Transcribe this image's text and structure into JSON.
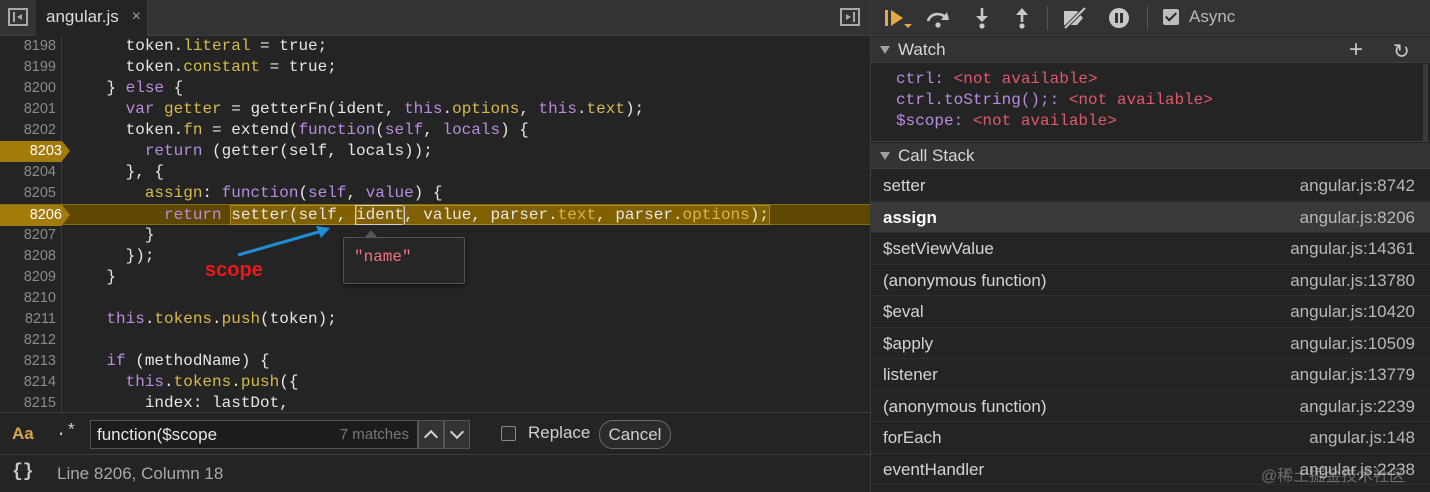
{
  "editor": {
    "tab_label": "angular.js",
    "tab_close": "×",
    "lines": [
      {
        "num": "8198",
        "html": "      token.<span class=\"prop\">literal</span> = <span class=\"val\">true</span>;"
      },
      {
        "num": "8199",
        "html": "      token.<span class=\"prop\">constant</span> = <span class=\"val\">true</span>;"
      },
      {
        "num": "8200",
        "html": "    } <span class=\"kw\">else</span> {"
      },
      {
        "num": "8201",
        "html": "      <span class=\"kw\">var</span> <span class=\"prop\">getter</span> = getterFn(ident, <span class=\"kw\">this</span>.<span class=\"prop\">options</span>, <span class=\"kw\">this</span>.<span class=\"prop\">text</span>);"
      },
      {
        "num": "8202",
        "html": "      token.<span class=\"prop\">fn</span> = extend(<span class=\"kw\">function</span>(<span class=\"kw\">self</span>, <span class=\"kw\">locals</span>) {"
      },
      {
        "num": "8203",
        "html": "        <span class=\"kw\">return</span> (getter(self, locals));",
        "breakpoint": true
      },
      {
        "num": "8204",
        "html": "      }, {"
      },
      {
        "num": "8205",
        "html": "        <span class=\"prop\">assign</span>: <span class=\"kw\">function</span>(<span class=\"kw\">self</span>, <span class=\"kw\">value</span>) {"
      },
      {
        "num": "8206",
        "html": "          <span class=\"kw\">return</span> <span class=\"hl\">setter(self, </span><span class=\"hl\" style=\"outline-color:#cfcfcf\">ident</span><span class=\"hl\">, value, parser.<span class=\"prop\">text</span>, parser.<span class=\"prop\">options</span>);</span>",
        "breakpoint": true,
        "current": true
      },
      {
        "num": "8207",
        "html": "        }"
      },
      {
        "num": "8208",
        "html": "      });"
      },
      {
        "num": "8209",
        "html": "    }"
      },
      {
        "num": "8210",
        "html": ""
      },
      {
        "num": "8211",
        "html": "    <span class=\"kw\">this</span>.<span class=\"prop\">tokens</span>.<span class=\"prop\">push</span>(token);"
      },
      {
        "num": "8212",
        "html": ""
      },
      {
        "num": "8213",
        "html": "    <span class=\"kw\">if</span> (methodName) {"
      },
      {
        "num": "8214",
        "html": "      <span class=\"kw\">this</span>.<span class=\"prop\">tokens</span>.<span class=\"prop\">push</span>({"
      },
      {
        "num": "8215",
        "html": "        index: lastDot,"
      }
    ],
    "tooltip_value": "\"name\"",
    "annotation": "scope"
  },
  "search": {
    "case_label": "Aa",
    "regex_label": ".*",
    "query": "function($scope",
    "match_count": "7 matches",
    "replace_label": "Replace",
    "cancel_label": "Cancel"
  },
  "status": {
    "pretty_print": "{}",
    "cursor": "Line 8206, Column 18"
  },
  "debugger": {
    "async_label": "Async",
    "watch": {
      "title": "Watch",
      "add": "+",
      "refresh": "↻",
      "items": [
        {
          "expr": "ctrl",
          "value": "<not available>"
        },
        {
          "expr": "ctrl.toString();",
          "value": "<not available>"
        },
        {
          "expr": "$scope",
          "value": "<not available>"
        }
      ]
    },
    "callstack": {
      "title": "Call Stack",
      "frames": [
        {
          "name": "setter",
          "loc": "angular.js:8742"
        },
        {
          "name": "assign",
          "loc": "angular.js:8206",
          "selected": true
        },
        {
          "name": "$setViewValue",
          "loc": "angular.js:14361"
        },
        {
          "name": "(anonymous function)",
          "loc": "angular.js:13780"
        },
        {
          "name": "$eval",
          "loc": "angular.js:10420"
        },
        {
          "name": "$apply",
          "loc": "angular.js:10509"
        },
        {
          "name": "listener",
          "loc": "angular.js:13779"
        },
        {
          "name": "(anonymous function)",
          "loc": "angular.js:2239"
        },
        {
          "name": "forEach",
          "loc": "angular.js:148"
        },
        {
          "name": "eventHandler",
          "loc": "angular.js:2238"
        }
      ]
    }
  },
  "watermark": "@稀土掘金技术社区"
}
